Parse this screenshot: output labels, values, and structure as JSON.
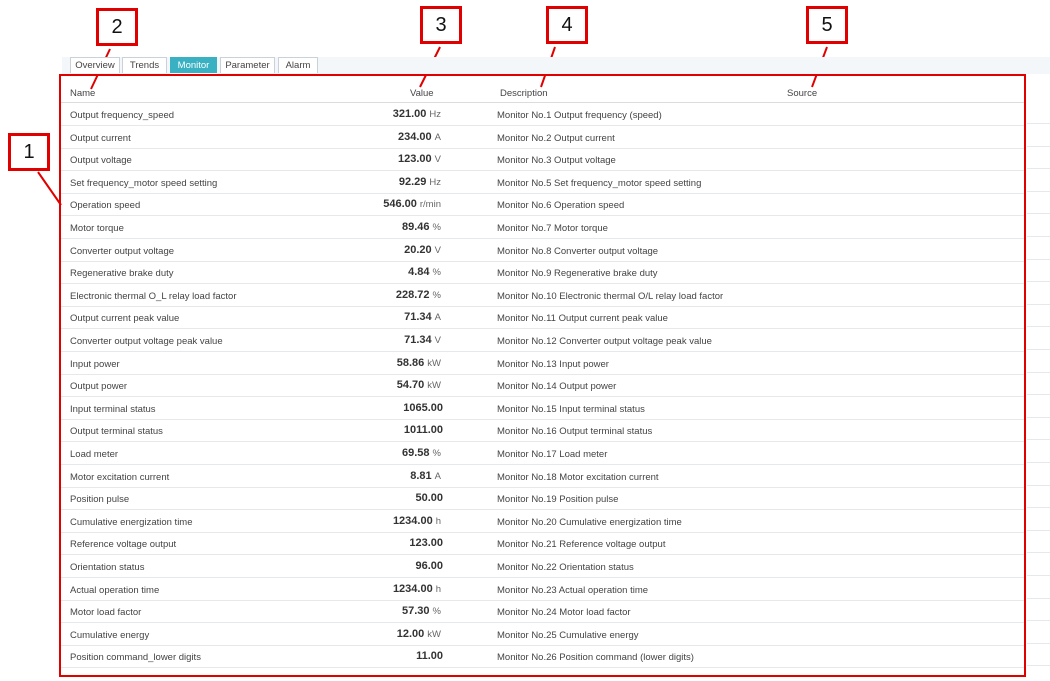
{
  "tabs": [
    {
      "label": "Overview",
      "active": false
    },
    {
      "label": "Trends",
      "active": false
    },
    {
      "label": "Monitor",
      "active": true
    },
    {
      "label": "Parameter",
      "active": false
    },
    {
      "label": "Alarm",
      "active": false
    }
  ],
  "columns": {
    "name": "Name",
    "value": "Value",
    "description": "Description",
    "source": "Source"
  },
  "callouts": [
    "1",
    "2",
    "3",
    "4",
    "5"
  ],
  "colors": {
    "accent_tab": "#3ab0c3",
    "callout_border": "#e00000"
  },
  "rows": [
    {
      "name": "Output frequency_speed",
      "value": "321.00",
      "unit": "Hz",
      "description": "Monitor No.1 Output frequency (speed)"
    },
    {
      "name": "Output current",
      "value": "234.00",
      "unit": "A",
      "description": "Monitor No.2 Output current"
    },
    {
      "name": "Output voltage",
      "value": "123.00",
      "unit": "V",
      "description": "Monitor No.3 Output voltage"
    },
    {
      "name": "Set frequency_motor speed setting",
      "value": "92.29",
      "unit": "Hz",
      "description": "Monitor No.5 Set frequency_motor speed setting"
    },
    {
      "name": "Operation speed",
      "value": "546.00",
      "unit": "r/min",
      "description": "Monitor No.6 Operation speed"
    },
    {
      "name": "Motor torque",
      "value": "89.46",
      "unit": "%",
      "description": "Monitor No.7 Motor torque"
    },
    {
      "name": "Converter output voltage",
      "value": "20.20",
      "unit": "V",
      "description": "Monitor No.8 Converter output voltage"
    },
    {
      "name": "Regenerative brake duty",
      "value": "4.84",
      "unit": "%",
      "description": "Monitor No.9 Regenerative brake duty"
    },
    {
      "name": "Electronic thermal O_L relay load factor",
      "value": "228.72",
      "unit": "%",
      "description": "Monitor No.10 Electronic thermal O/L relay load factor"
    },
    {
      "name": "Output current peak value",
      "value": "71.34",
      "unit": "A",
      "description": "Monitor No.11 Output current peak value"
    },
    {
      "name": "Converter output voltage peak value",
      "value": "71.34",
      "unit": "V",
      "description": "Monitor No.12 Converter output voltage peak value"
    },
    {
      "name": "Input power",
      "value": "58.86",
      "unit": "kW",
      "description": "Monitor No.13 Input power"
    },
    {
      "name": "Output power",
      "value": "54.70",
      "unit": "kW",
      "description": "Monitor No.14 Output power"
    },
    {
      "name": "Input terminal status",
      "value": "1065.00",
      "unit": "",
      "description": "Monitor No.15 Input terminal status"
    },
    {
      "name": "Output terminal status",
      "value": "1011.00",
      "unit": "",
      "description": "Monitor No.16 Output terminal status"
    },
    {
      "name": "Load meter",
      "value": "69.58",
      "unit": "%",
      "description": "Monitor No.17 Load meter"
    },
    {
      "name": "Motor excitation current",
      "value": "8.81",
      "unit": "A",
      "description": "Monitor No.18 Motor excitation current"
    },
    {
      "name": "Position pulse",
      "value": "50.00",
      "unit": "",
      "description": "Monitor No.19 Position pulse"
    },
    {
      "name": "Cumulative energization time",
      "value": "1234.00",
      "unit": "h",
      "description": "Monitor No.20 Cumulative energization time"
    },
    {
      "name": "Reference voltage output",
      "value": "123.00",
      "unit": "",
      "description": "Monitor No.21 Reference voltage output"
    },
    {
      "name": "Orientation status",
      "value": "96.00",
      "unit": "",
      "description": "Monitor No.22 Orientation status"
    },
    {
      "name": "Actual operation time",
      "value": "1234.00",
      "unit": "h",
      "description": "Monitor No.23 Actual operation time"
    },
    {
      "name": "Motor load factor",
      "value": "57.30",
      "unit": "%",
      "description": "Monitor No.24 Motor load factor"
    },
    {
      "name": "Cumulative energy",
      "value": "12.00",
      "unit": "kW",
      "description": "Monitor No.25 Cumulative energy"
    },
    {
      "name": "Position command_lower digits",
      "value": "11.00",
      "unit": "",
      "description": "Monitor No.26 Position command (lower digits)"
    }
  ]
}
